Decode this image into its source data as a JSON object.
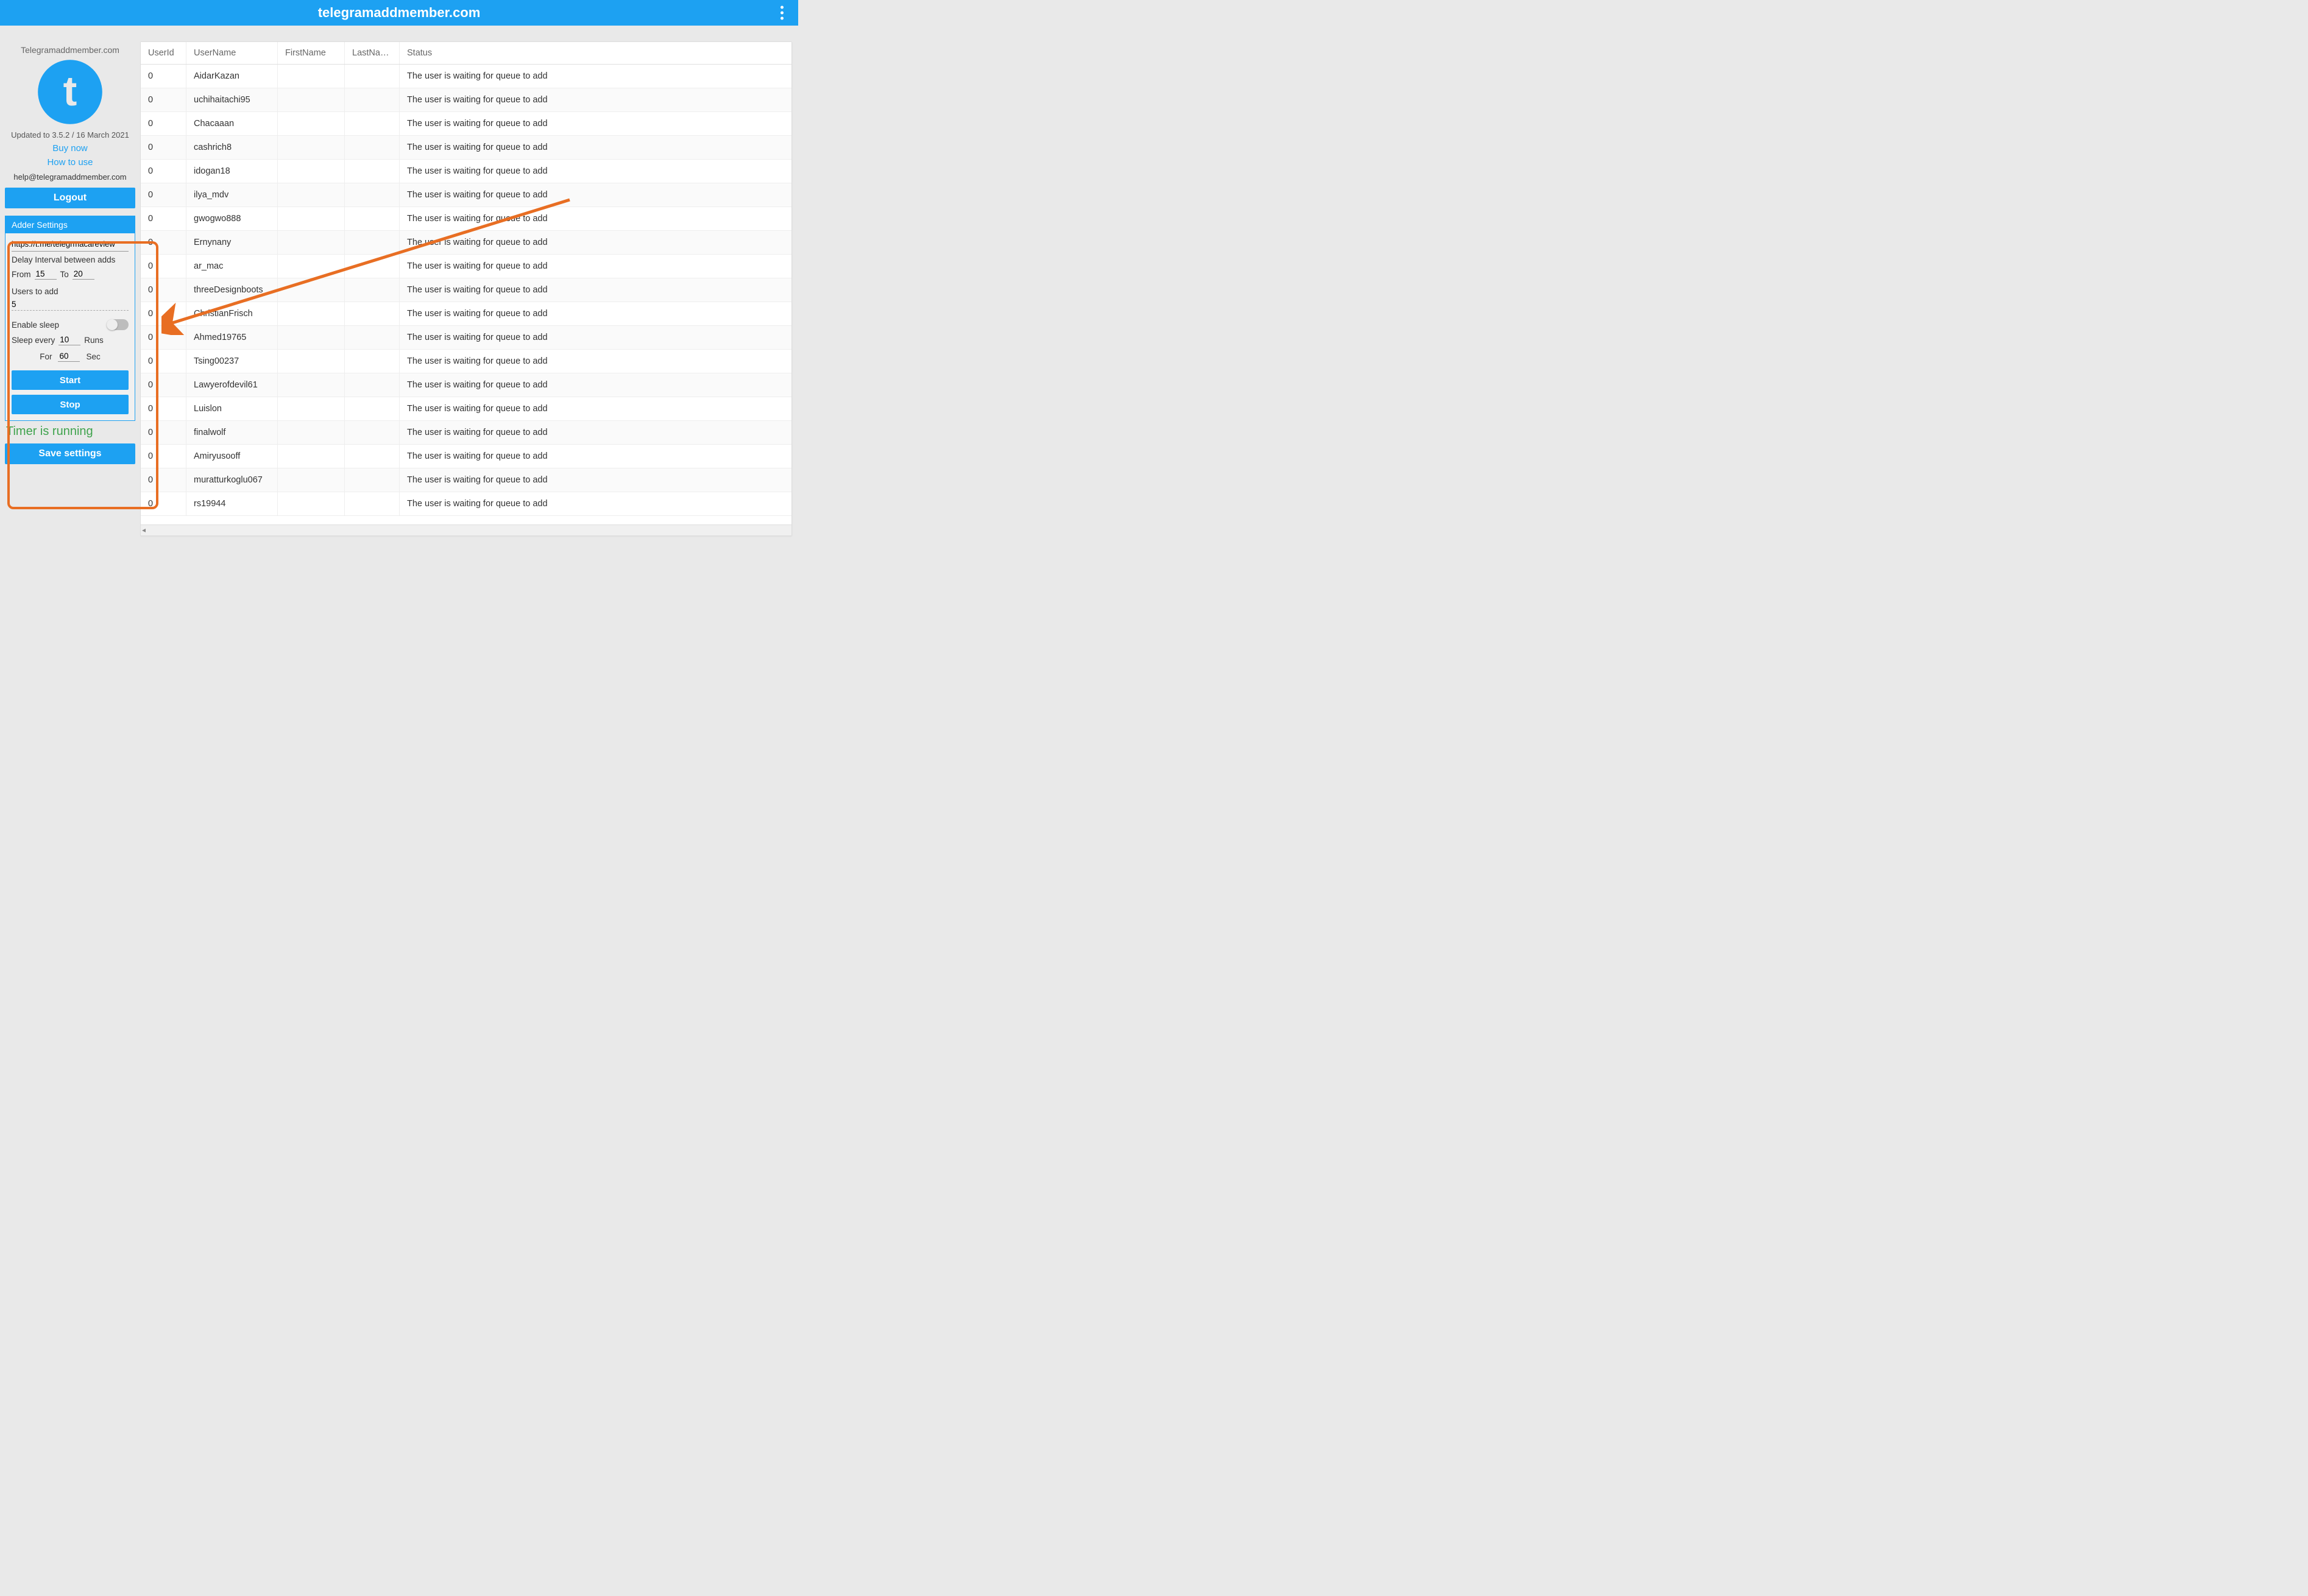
{
  "titlebar": {
    "title": "telegramaddmember.com"
  },
  "sidebar": {
    "brand": "Telegramaddmember.com",
    "version": "Updated to 3.5.2 / 16 March 2021",
    "buy_link": "Buy now",
    "howto_link": "How to use",
    "email": "help@telegramaddmember.com",
    "logout": "Logout",
    "save": "Save settings",
    "timer_status": "Timer is running"
  },
  "adder": {
    "header": "Adder Settings",
    "url": "https://t.me/telegrmacareview",
    "delay_label": "Delay Interval between adds",
    "from_label": "From",
    "from_value": "15",
    "to_label": "To",
    "to_value": "20",
    "users_label": "Users to add",
    "users_value": "5",
    "sleep_label": "Enable sleep",
    "sleep_every_label": "Sleep every",
    "sleep_every_value": "10",
    "runs_label": "Runs",
    "for_label": "For",
    "for_value": "60",
    "sec_label": "Sec",
    "start": "Start",
    "stop": "Stop"
  },
  "table": {
    "columns": {
      "userid": "UserId",
      "username": "UserName",
      "firstname": "FirstName",
      "lastname": "LastName",
      "status": "Status"
    },
    "rows": [
      {
        "userid": "0",
        "username": "AidarKazan",
        "firstname": "",
        "lastname": "",
        "status": "The user is waiting for queue to add"
      },
      {
        "userid": "0",
        "username": "uchihaitachi95",
        "firstname": "",
        "lastname": "",
        "status": "The user is waiting for queue to add"
      },
      {
        "userid": "0",
        "username": "Chacaaan",
        "firstname": "",
        "lastname": "",
        "status": "The user is waiting for queue to add"
      },
      {
        "userid": "0",
        "username": "cashrich8",
        "firstname": "",
        "lastname": "",
        "status": "The user is waiting for queue to add"
      },
      {
        "userid": "0",
        "username": "idogan18",
        "firstname": "",
        "lastname": "",
        "status": "The user is waiting for queue to add"
      },
      {
        "userid": "0",
        "username": "ilya_mdv",
        "firstname": "",
        "lastname": "",
        "status": "The user is waiting for queue to add"
      },
      {
        "userid": "0",
        "username": "gwogwo888",
        "firstname": "",
        "lastname": "",
        "status": "The user is waiting for queue to add"
      },
      {
        "userid": "0",
        "username": "Ernynany",
        "firstname": "",
        "lastname": "",
        "status": "The user is waiting for queue to add"
      },
      {
        "userid": "0",
        "username": "ar_mac",
        "firstname": "",
        "lastname": "",
        "status": "The user is waiting for queue to add"
      },
      {
        "userid": "0",
        "username": "threeDesignboots",
        "firstname": "",
        "lastname": "",
        "status": "The user is waiting for queue to add"
      },
      {
        "userid": "0",
        "username": "ChristianFrisch",
        "firstname": "",
        "lastname": "",
        "status": "The user is waiting for queue to add"
      },
      {
        "userid": "0",
        "username": "Ahmed19765",
        "firstname": "",
        "lastname": "",
        "status": "The user is waiting for queue to add"
      },
      {
        "userid": "0",
        "username": "Tsing00237",
        "firstname": "",
        "lastname": "",
        "status": "The user is waiting for queue to add"
      },
      {
        "userid": "0",
        "username": "Lawyerofdevil61",
        "firstname": "",
        "lastname": "",
        "status": "The user is waiting for queue to add"
      },
      {
        "userid": "0",
        "username": "Luislon",
        "firstname": "",
        "lastname": "",
        "status": "The user is waiting for queue to add"
      },
      {
        "userid": "0",
        "username": "finalwolf",
        "firstname": "",
        "lastname": "",
        "status": "The user is waiting for queue to add"
      },
      {
        "userid": "0",
        "username": "Amiryusooff",
        "firstname": "",
        "lastname": "",
        "status": "The user is waiting for queue to add"
      },
      {
        "userid": "0",
        "username": "muratturkoglu067",
        "firstname": "",
        "lastname": "",
        "status": "The user is waiting for queue to add"
      },
      {
        "userid": "0",
        "username": "rs19944",
        "firstname": "",
        "lastname": "",
        "status": "The user is waiting for queue to add"
      }
    ]
  }
}
